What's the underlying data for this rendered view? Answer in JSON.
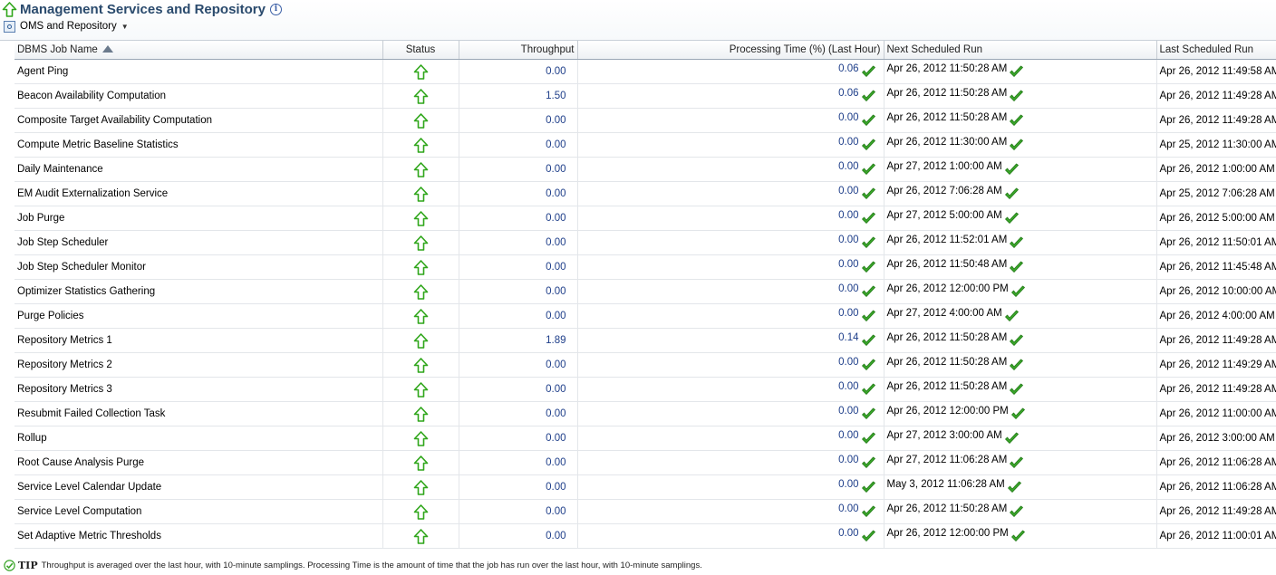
{
  "header": {
    "title": "Management Services and Repository",
    "target_menu": "OMS and Repository"
  },
  "table": {
    "columns": {
      "name": "DBMS Job Name",
      "status": "Status",
      "throughput": "Throughput",
      "processing": "Processing Time (%) (Last Hour)",
      "next_run": "Next Scheduled Run",
      "last_run": "Last Scheduled Run"
    },
    "rows": [
      {
        "name": "Agent Ping",
        "throughput": "0.00",
        "processing": "0.06",
        "next": "Apr 26, 2012 11:50:28 AM",
        "last": "Apr 26, 2012 11:49:58 AM"
      },
      {
        "name": "Beacon Availability Computation",
        "throughput": "1.50",
        "processing": "0.06",
        "next": "Apr 26, 2012 11:50:28 AM",
        "last": "Apr 26, 2012 11:49:28 AM"
      },
      {
        "name": "Composite Target Availability Computation",
        "throughput": "0.00",
        "processing": "0.00",
        "next": "Apr 26, 2012 11:50:28 AM",
        "last": "Apr 26, 2012 11:49:28 AM"
      },
      {
        "name": "Compute Metric Baseline Statistics",
        "throughput": "0.00",
        "processing": "0.00",
        "next": "Apr 26, 2012 11:30:00 AM",
        "last": "Apr 25, 2012 11:30:00 AM"
      },
      {
        "name": "Daily Maintenance",
        "throughput": "0.00",
        "processing": "0.00",
        "next": "Apr 27, 2012 1:00:00 AM",
        "last": "Apr 26, 2012 1:00:00 AM"
      },
      {
        "name": "EM Audit Externalization Service",
        "throughput": "0.00",
        "processing": "0.00",
        "next": "Apr 26, 2012 7:06:28 AM",
        "last": "Apr 25, 2012 7:06:28 AM"
      },
      {
        "name": "Job Purge",
        "throughput": "0.00",
        "processing": "0.00",
        "next": "Apr 27, 2012 5:00:00 AM",
        "last": "Apr 26, 2012 5:00:00 AM"
      },
      {
        "name": "Job Step Scheduler",
        "throughput": "0.00",
        "processing": "0.00",
        "next": "Apr 26, 2012 11:52:01 AM",
        "last": "Apr 26, 2012 11:50:01 AM"
      },
      {
        "name": "Job Step Scheduler Monitor",
        "throughput": "0.00",
        "processing": "0.00",
        "next": "Apr 26, 2012 11:50:48 AM",
        "last": "Apr 26, 2012 11:45:48 AM"
      },
      {
        "name": "Optimizer Statistics Gathering",
        "throughput": "0.00",
        "processing": "0.00",
        "next": "Apr 26, 2012 12:00:00 PM",
        "last": "Apr 26, 2012 10:00:00 AM"
      },
      {
        "name": "Purge Policies",
        "throughput": "0.00",
        "processing": "0.00",
        "next": "Apr 27, 2012 4:00:00 AM",
        "last": "Apr 26, 2012 4:00:00 AM"
      },
      {
        "name": "Repository Metrics 1",
        "throughput": "1.89",
        "processing": "0.14",
        "next": "Apr 26, 2012 11:50:28 AM",
        "last": "Apr 26, 2012 11:49:28 AM"
      },
      {
        "name": "Repository Metrics 2",
        "throughput": "0.00",
        "processing": "0.00",
        "next": "Apr 26, 2012 11:50:28 AM",
        "last": "Apr 26, 2012 11:49:29 AM"
      },
      {
        "name": "Repository Metrics 3",
        "throughput": "0.00",
        "processing": "0.00",
        "next": "Apr 26, 2012 11:50:28 AM",
        "last": "Apr 26, 2012 11:49:28 AM"
      },
      {
        "name": "Resubmit Failed Collection Task",
        "throughput": "0.00",
        "processing": "0.00",
        "next": "Apr 26, 2012 12:00:00 PM",
        "last": "Apr 26, 2012 11:00:00 AM"
      },
      {
        "name": "Rollup",
        "throughput": "0.00",
        "processing": "0.00",
        "next": "Apr 27, 2012 3:00:00 AM",
        "last": "Apr 26, 2012 3:00:00 AM"
      },
      {
        "name": "Root Cause Analysis Purge",
        "throughput": "0.00",
        "processing": "0.00",
        "next": "Apr 27, 2012 11:06:28 AM",
        "last": "Apr 26, 2012 11:06:28 AM"
      },
      {
        "name": "Service Level Calendar Update",
        "throughput": "0.00",
        "processing": "0.00",
        "next": "May 3, 2012 11:06:28 AM",
        "last": "Apr 26, 2012 11:06:28 AM"
      },
      {
        "name": "Service Level Computation",
        "throughput": "0.00",
        "processing": "0.00",
        "next": "Apr 26, 2012 11:50:28 AM",
        "last": "Apr 26, 2012 11:49:28 AM"
      },
      {
        "name": "Set Adaptive Metric Thresholds",
        "throughput": "0.00",
        "processing": "0.00",
        "next": "Apr 26, 2012 12:00:00 PM",
        "last": "Apr 26, 2012 11:00:01 AM"
      }
    ]
  },
  "tip": {
    "label": "TIP",
    "text": "Throughput is averaged over the last hour, with 10-minute samplings. Processing Time is the amount of time that the job has run over the last hour, with 10-minute samplings."
  },
  "icons": {
    "status": "up-arrow-icon",
    "ok": "check-icon"
  },
  "colors": {
    "title": "#2a4a6d",
    "link_value": "#1f3f8a",
    "status_green": "#2fa61a",
    "check_green": "#3aa52a"
  }
}
